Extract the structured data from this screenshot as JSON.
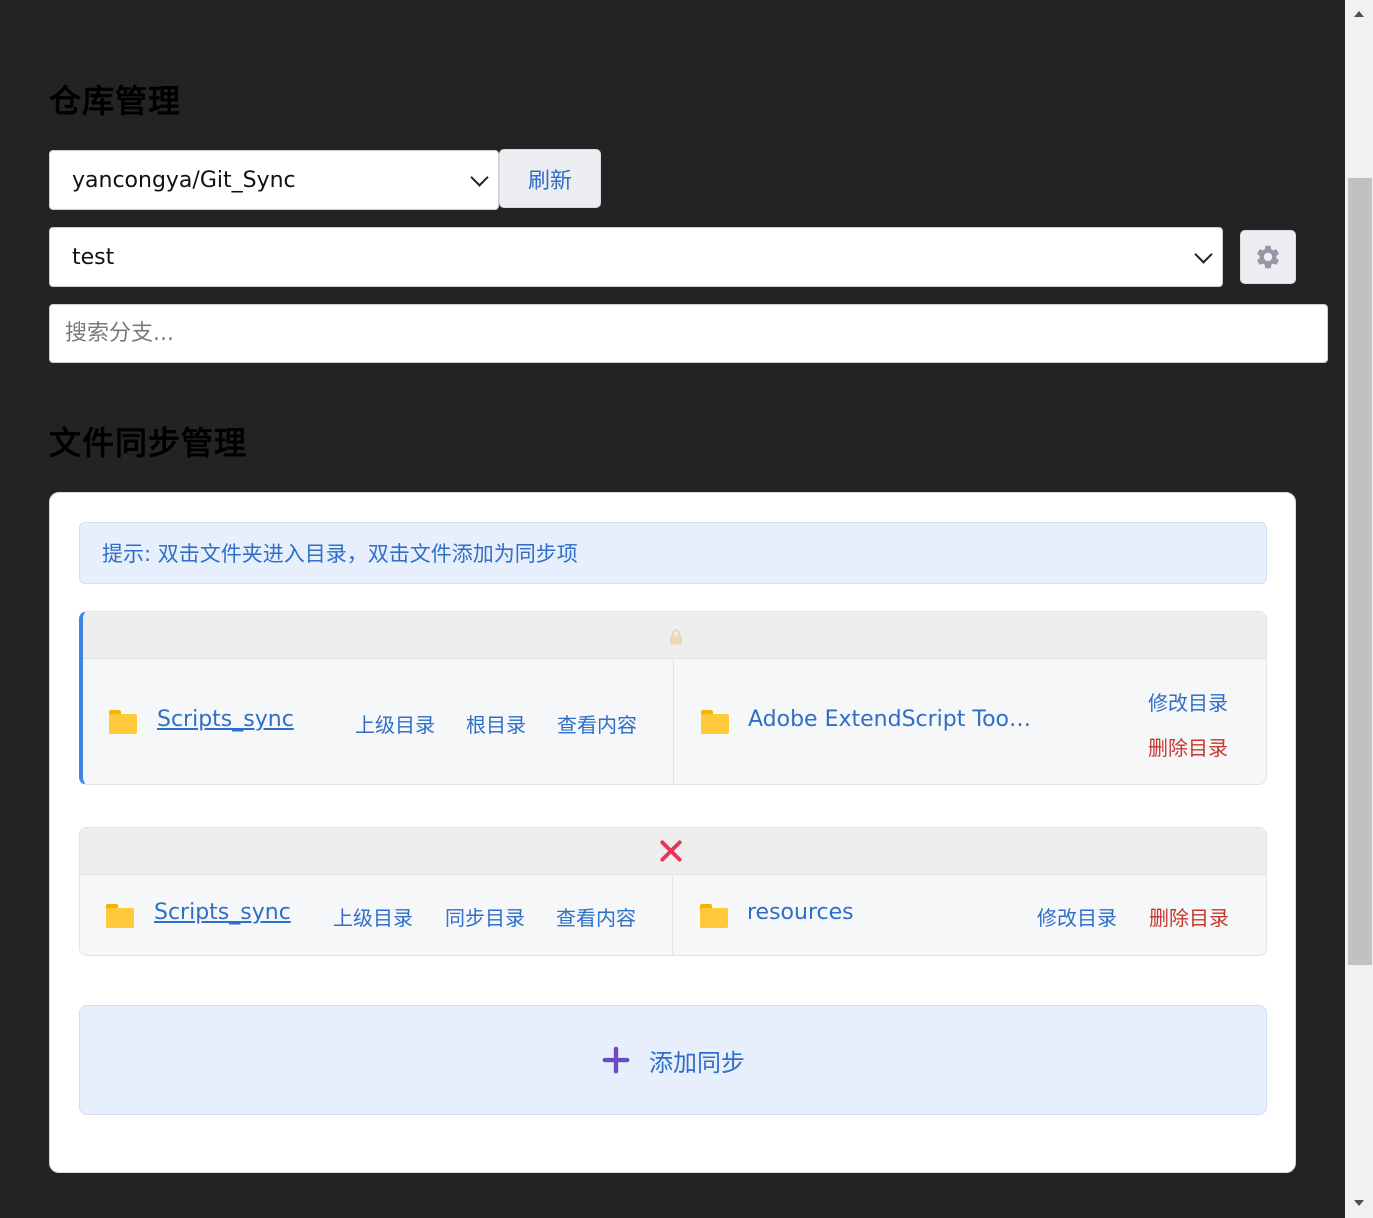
{
  "repo_section": {
    "title": "仓库管理",
    "repo_select_value": "yancongya/Git_Sync",
    "refresh_label": "刷新",
    "branch_select_value": "test",
    "search_placeholder": "搜索分支...",
    "settings_icon": "gear-icon"
  },
  "sync_section": {
    "title": "文件同步管理",
    "hint": "提示: 双击文件夹进入目录，双击文件添加为同步项",
    "items": [
      {
        "status_icon": "lock-icon",
        "source_name": "Scripts_sync",
        "source_actions": [
          "上级目录",
          "根目录",
          "查看内容"
        ],
        "target_name": "Adobe ExtendScript Too…",
        "edit_label": "修改目录",
        "delete_label": "删除目录"
      },
      {
        "status_icon": "x-icon",
        "source_name": "Scripts_sync",
        "source_actions": [
          "上级目录",
          "同步目录",
          "查看内容"
        ],
        "target_name": "resources",
        "edit_label": "修改目录",
        "delete_label": "删除目录"
      }
    ],
    "add_sync_label": "添加同步"
  },
  "colors": {
    "background": "#232323",
    "accent": "#2f6ec9",
    "danger": "#c4382e",
    "hint_bg": "#e8effc",
    "active_border": "#3d84e6",
    "folder": "#ffc93a",
    "x_mark": "#e8355a",
    "plus": "#6a4bc4"
  }
}
